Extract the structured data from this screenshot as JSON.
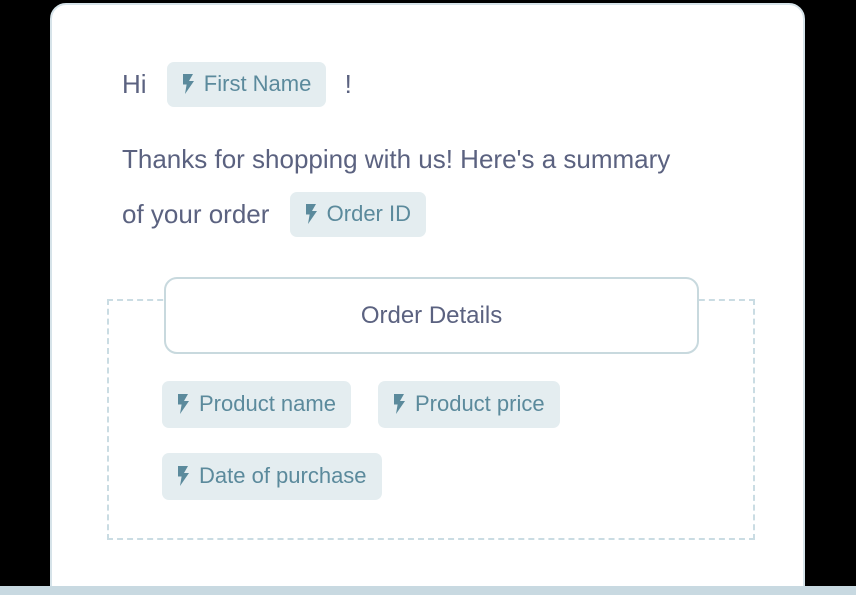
{
  "card": {
    "accent_color": "#c8d9e1",
    "border_color": "#d6e3e9"
  },
  "body_text": {
    "greeting_prefix": "Hi",
    "greeting_suffix": "!",
    "thanks_line_1": "Thanks for shopping with us! Here's a summary",
    "thanks_line_2": "of your order"
  },
  "merge_tags": {
    "icon_name": "lightning-bolt-icon",
    "first_name": "First Name",
    "order_id": "Order ID",
    "product_name": "Product name",
    "product_price": "Product price",
    "date_of_purchase": "Date of purchase"
  },
  "order_details_button": {
    "label": "Order Details"
  },
  "colors": {
    "chip_background": "#e4edf0",
    "chip_text": "#5b8a9c",
    "body_text": "#5b6280",
    "dashed_border": "#cadce3",
    "button_border": "#c8d9de"
  }
}
